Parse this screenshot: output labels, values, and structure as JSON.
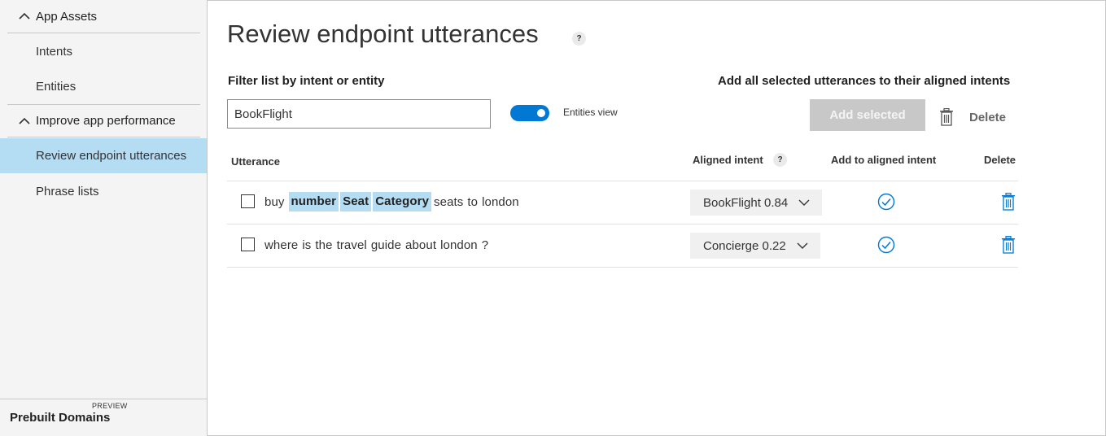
{
  "sidebar": {
    "groups": [
      {
        "label": "App Assets",
        "items": [
          {
            "label": "Intents"
          },
          {
            "label": "Entities"
          }
        ]
      },
      {
        "label": "Improve app performance",
        "items": [
          {
            "label": "Review endpoint utterances",
            "active": true
          },
          {
            "label": "Phrase lists"
          }
        ]
      }
    ],
    "prebuilt": {
      "label": "Prebuilt Domains",
      "badge": "PREVIEW"
    }
  },
  "page": {
    "title": "Review endpoint utterances",
    "help_glyph": "?"
  },
  "filter": {
    "label": "Filter list by intent or entity",
    "value": "BookFlight",
    "placeholder": ""
  },
  "entities_view": {
    "label": "Entities view",
    "on": true
  },
  "bulk": {
    "label": "Add all selected utterances to their aligned intents",
    "add_selected_label": "Add selected",
    "delete_label": "Delete"
  },
  "table": {
    "headers": {
      "utterance": "Utterance",
      "aligned_intent": "Aligned intent",
      "aligned_help": "?",
      "add_to_aligned": "Add to aligned intent",
      "delete": "Delete"
    },
    "rows": [
      {
        "checked": false,
        "tokens": [
          {
            "text": "buy",
            "entity": false
          },
          {
            "text": "number",
            "entity": true
          },
          {
            "text": "Seat",
            "entity": true
          },
          {
            "text": "Category",
            "entity": true
          },
          {
            "text": "seats",
            "entity": false
          },
          {
            "text": "to",
            "entity": false
          },
          {
            "text": "london",
            "entity": false
          }
        ],
        "intent": "BookFlight 0.84"
      },
      {
        "checked": false,
        "tokens": [
          {
            "text": "where",
            "entity": false
          },
          {
            "text": "is",
            "entity": false
          },
          {
            "text": "the",
            "entity": false
          },
          {
            "text": "travel",
            "entity": false
          },
          {
            "text": "guide",
            "entity": false
          },
          {
            "text": "about",
            "entity": false
          },
          {
            "text": "london",
            "entity": false
          },
          {
            "text": "?",
            "entity": false
          }
        ],
        "intent": "Concierge 0.22"
      }
    ]
  },
  "colors": {
    "accent": "#0078d4",
    "entity_highlight": "#b4dcf3",
    "sidebar_bg": "#f4f4f4",
    "disabled_button": "#c8c8c8"
  },
  "icons": {
    "chevron_up": "chevron-up-icon",
    "chevron_down": "chevron-down-icon",
    "trash": "trash-icon",
    "check": "check-circle-icon",
    "help": "help-icon"
  }
}
